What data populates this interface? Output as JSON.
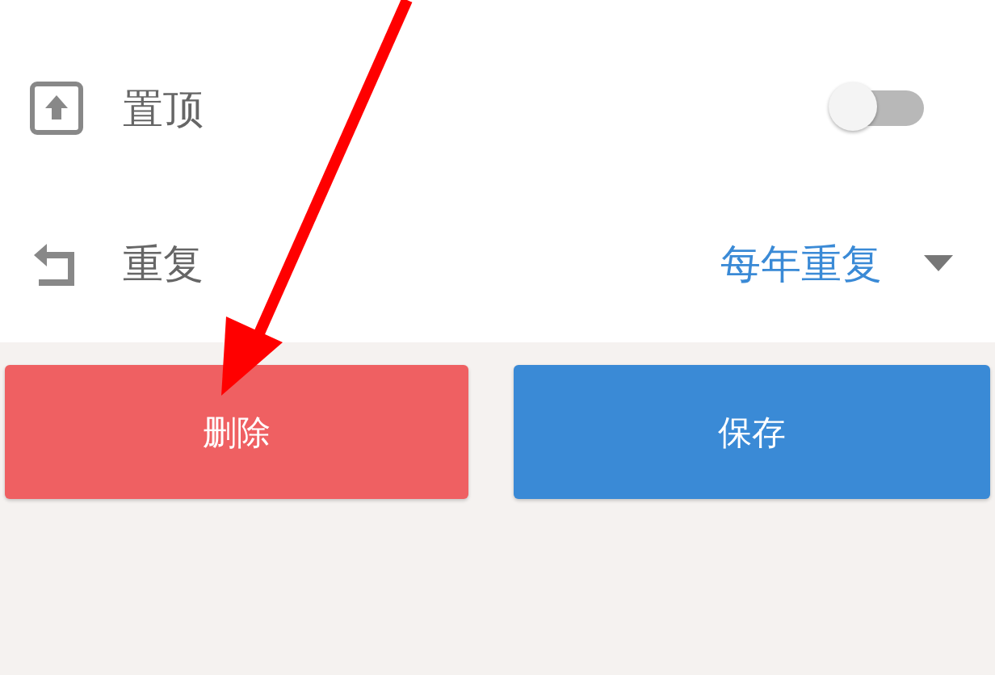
{
  "settings": [
    {
      "kind": "toggle",
      "label": "置顶",
      "on": false
    },
    {
      "kind": "dropdown",
      "label": "重复",
      "value": "每年重复"
    }
  ],
  "buttons": [
    {
      "label": "删除",
      "kind": "danger"
    },
    {
      "label": "保存",
      "kind": "primary"
    }
  ]
}
